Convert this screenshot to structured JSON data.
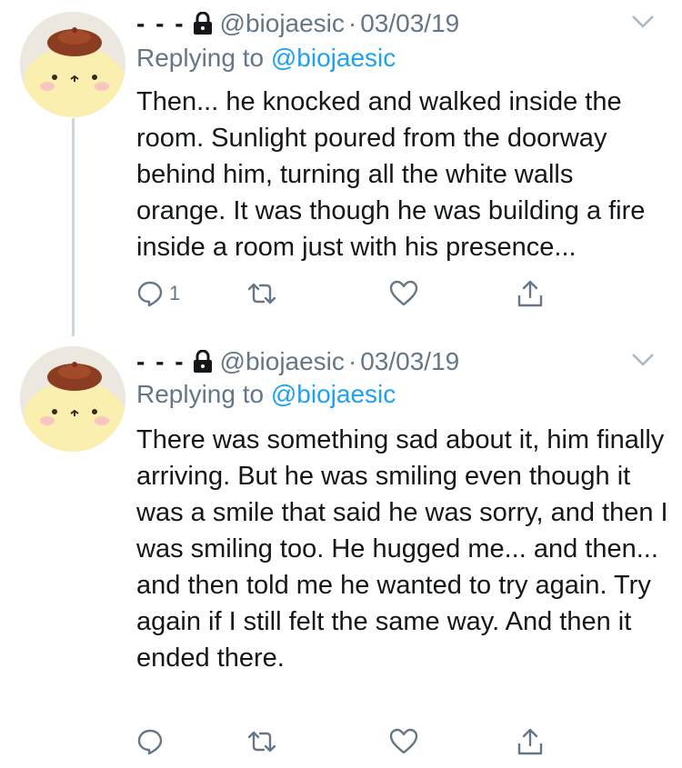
{
  "tweets": [
    {
      "display_name": "- - -",
      "handle": "@biojaesic",
      "separator": "·",
      "date": "03/03/19",
      "replying_prefix": "Replying to",
      "replying_to": "@biojaesic",
      "text": "Then... he knocked and walked inside the room. Sunlight poured from the doorway behind him, turning all the white walls orange. It was though he was building a fire inside a room just with his presence...",
      "reply_count": "1"
    },
    {
      "display_name": "- - -",
      "handle": "@biojaesic",
      "separator": "·",
      "date": "03/03/19",
      "replying_prefix": "Replying to",
      "replying_to": "@biojaesic",
      "text": "There was something sad about it, him finally arriving. But he was smiling even though it was a smile that said he was sorry, and then I was smiling too. He hugged me... and then... and then told me he wanted to try again. Try again if I still felt the same way. And then it ended there.",
      "reply_count": ""
    }
  ],
  "icons": {
    "lock": "lock-icon",
    "chevron": "chevron-down-icon",
    "reply": "reply-icon",
    "retweet": "retweet-icon",
    "like": "heart-icon",
    "share": "share-icon"
  },
  "colors": {
    "text": "#14171a",
    "secondary": "#657786",
    "link": "#1da1f2",
    "thread_line": "#ccd6dd"
  }
}
